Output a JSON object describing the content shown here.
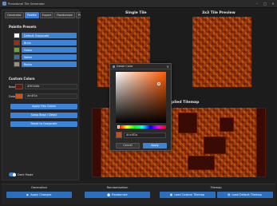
{
  "window": {
    "title": "Procedural Tile Generator"
  },
  "tabs": [
    {
      "label": "Generator",
      "active": false
    },
    {
      "label": "Palette",
      "active": true
    },
    {
      "label": "Export",
      "active": false
    },
    {
      "label": "Randomize",
      "active": false
    },
    {
      "label": "Presets",
      "active": false
    }
  ],
  "palette_presets": {
    "title": "Palette Presets",
    "items": [
      {
        "label": "Default Grayscale",
        "color": "#ffffff"
      },
      {
        "label": "Brick",
        "color": "#a22a12"
      },
      {
        "label": "Grass",
        "color": "#6f9e3a"
      },
      {
        "label": "Water",
        "color": "#3d6f9d"
      },
      {
        "label": "Rocks",
        "color": "#9a8f86"
      }
    ]
  },
  "custom_colors": {
    "title": "Custom Colors",
    "base": {
      "label": "Base",
      "hex": "#5f1b0b",
      "color": "#5f1b0b"
    },
    "detail": {
      "label": "Detail",
      "hex": "#c4f1a",
      "color": "#c4561a"
    },
    "buttons": {
      "apply": "Apply Hex Colors",
      "swap": "Swap Base / Detail",
      "reset": "Reset to Grayscale"
    }
  },
  "dark_mode": {
    "label": "Dark Mode",
    "on": true
  },
  "previews": {
    "single_tile": "Single Tile",
    "tile_preview": "3x3 Tile Preview",
    "tilemap": "plied Tilemap"
  },
  "dialog": {
    "title": "Detail Color",
    "hex_value": "#cc4f1a",
    "preview_color": "#c54f1a",
    "cancel": "Cancel",
    "apply": "Apply"
  },
  "bottom": {
    "generation": {
      "title": "Generation",
      "button": "Apply Changes"
    },
    "randomization": {
      "title": "Randomization",
      "button": "Randomize"
    },
    "tilemap": {
      "title": "Tilemap",
      "load_custom": "Load Custom Tilemap",
      "load_default": "Load Default Tilemap"
    }
  }
}
